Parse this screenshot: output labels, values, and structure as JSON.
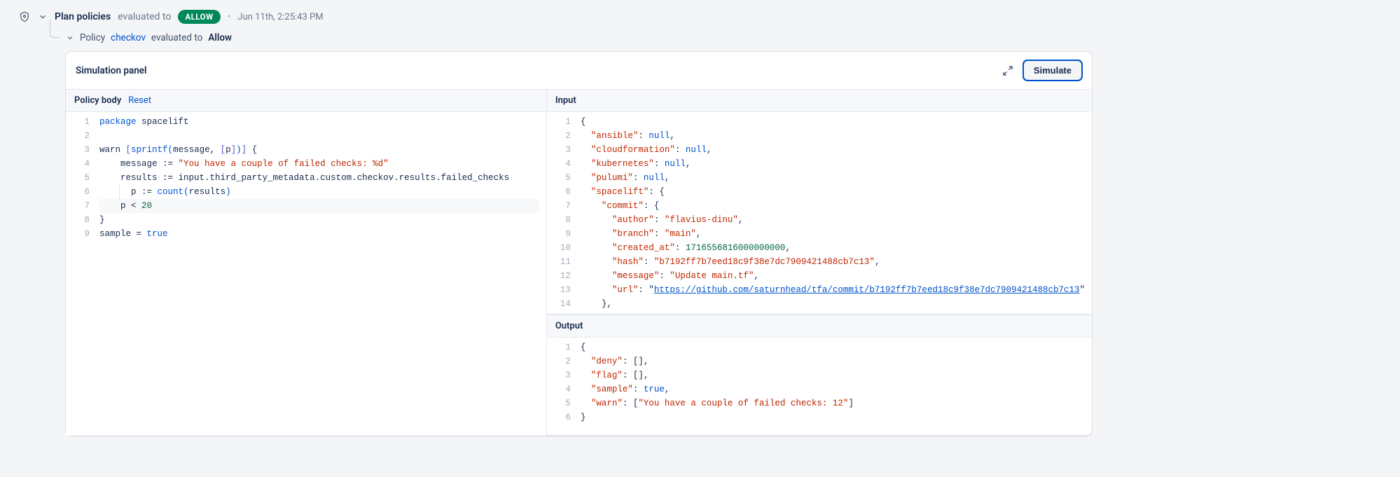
{
  "header": {
    "title": "Plan policies",
    "evaluated_to_text": "evaluated to",
    "badge": "ALLOW",
    "timestamp": "Jun 11th, 2:25:43 PM"
  },
  "sub_header": {
    "policy_label": "Policy",
    "policy_name": "checkov",
    "evaluated_to_text": "evaluated to",
    "result": "Allow"
  },
  "panel": {
    "title": "Simulation panel",
    "simulate_label": "Simulate"
  },
  "policy_body": {
    "title": "Policy body",
    "reset_label": "Reset",
    "lines": [
      [
        {
          "t": "package",
          "c": "tok-kw"
        },
        {
          "t": " spacelift",
          "c": "tok-id"
        }
      ],
      [],
      [
        {
          "t": "warn ",
          "c": "tok-id"
        },
        {
          "t": "[",
          "c": "tok-pn"
        },
        {
          "t": "sprintf",
          "c": "tok-fn"
        },
        {
          "t": "(",
          "c": "tok-pn2"
        },
        {
          "t": "message",
          "c": "tok-id"
        },
        {
          "t": ", ",
          "c": "tok-id"
        },
        {
          "t": "[",
          "c": "tok-pn"
        },
        {
          "t": "p",
          "c": "tok-id"
        },
        {
          "t": "]",
          "c": "tok-pn"
        },
        {
          "t": ")",
          "c": "tok-pn2"
        },
        {
          "t": "]",
          "c": "tok-pn"
        },
        {
          "t": " {",
          "c": ""
        }
      ],
      [
        {
          "t": "    message ",
          "c": "tok-id"
        },
        {
          "t": ":=",
          "c": "tok-op"
        },
        {
          "t": " ",
          "c": ""
        },
        {
          "t": "\"You have a couple of failed checks: %d\"",
          "c": "tok-str"
        }
      ],
      [
        {
          "t": "    results ",
          "c": "tok-id"
        },
        {
          "t": ":=",
          "c": "tok-op"
        },
        {
          "t": " input.third_party_metadata.custom.checkov.results.failed_checks",
          "c": "tok-id"
        }
      ],
      [
        {
          "t": "      p ",
          "c": "tok-id"
        },
        {
          "t": ":=",
          "c": "tok-op"
        },
        {
          "t": " ",
          "c": ""
        },
        {
          "t": "count",
          "c": "tok-fn"
        },
        {
          "t": "(",
          "c": "tok-pn2"
        },
        {
          "t": "results",
          "c": "tok-id"
        },
        {
          "t": ")",
          "c": "tok-pn2"
        }
      ],
      [
        {
          "t": "    p ",
          "c": "tok-id"
        },
        {
          "t": "<",
          "c": "tok-op"
        },
        {
          "t": " ",
          "c": ""
        },
        {
          "t": "20",
          "c": "tok-num"
        }
      ],
      [
        {
          "t": "}",
          "c": ""
        }
      ],
      [
        {
          "t": "sample ",
          "c": "tok-id"
        },
        {
          "t": "= ",
          "c": "tok-op"
        },
        {
          "t": "true",
          "c": "tok-bool"
        }
      ]
    ],
    "highlight_line_index": 6,
    "indent_bar_lines": [
      5
    ]
  },
  "input": {
    "title": "Input",
    "lines": [
      [
        {
          "t": "{",
          "c": ""
        }
      ],
      [
        {
          "t": "  ",
          "c": ""
        },
        {
          "t": "\"ansible\"",
          "c": "tok-key"
        },
        {
          "t": ": ",
          "c": ""
        },
        {
          "t": "null",
          "c": "tok-null"
        },
        {
          "t": ",",
          "c": ""
        }
      ],
      [
        {
          "t": "  ",
          "c": ""
        },
        {
          "t": "\"cloudformation\"",
          "c": "tok-key"
        },
        {
          "t": ": ",
          "c": ""
        },
        {
          "t": "null",
          "c": "tok-null"
        },
        {
          "t": ",",
          "c": ""
        }
      ],
      [
        {
          "t": "  ",
          "c": ""
        },
        {
          "t": "\"kubernetes\"",
          "c": "tok-key"
        },
        {
          "t": ": ",
          "c": ""
        },
        {
          "t": "null",
          "c": "tok-null"
        },
        {
          "t": ",",
          "c": ""
        }
      ],
      [
        {
          "t": "  ",
          "c": ""
        },
        {
          "t": "\"pulumi\"",
          "c": "tok-key"
        },
        {
          "t": ": ",
          "c": ""
        },
        {
          "t": "null",
          "c": "tok-null"
        },
        {
          "t": ",",
          "c": ""
        }
      ],
      [
        {
          "t": "  ",
          "c": ""
        },
        {
          "t": "\"spacelift\"",
          "c": "tok-key"
        },
        {
          "t": ": {",
          "c": ""
        }
      ],
      [
        {
          "t": "    ",
          "c": ""
        },
        {
          "t": "\"commit\"",
          "c": "tok-key"
        },
        {
          "t": ": {",
          "c": ""
        }
      ],
      [
        {
          "t": "      ",
          "c": ""
        },
        {
          "t": "\"author\"",
          "c": "tok-key"
        },
        {
          "t": ": ",
          "c": ""
        },
        {
          "t": "\"flavius-dinu\"",
          "c": "tok-str"
        },
        {
          "t": ",",
          "c": ""
        }
      ],
      [
        {
          "t": "      ",
          "c": ""
        },
        {
          "t": "\"branch\"",
          "c": "tok-key"
        },
        {
          "t": ": ",
          "c": ""
        },
        {
          "t": "\"main\"",
          "c": "tok-str"
        },
        {
          "t": ",",
          "c": ""
        }
      ],
      [
        {
          "t": "      ",
          "c": ""
        },
        {
          "t": "\"created_at\"",
          "c": "tok-key"
        },
        {
          "t": ": ",
          "c": ""
        },
        {
          "t": "1716556816000000000",
          "c": "tok-num"
        },
        {
          "t": ",",
          "c": ""
        }
      ],
      [
        {
          "t": "      ",
          "c": ""
        },
        {
          "t": "\"hash\"",
          "c": "tok-key"
        },
        {
          "t": ": ",
          "c": ""
        },
        {
          "t": "\"b7192ff7b7eed18c9f38e7dc7909421488cb7c13\"",
          "c": "tok-str"
        },
        {
          "t": ",",
          "c": ""
        }
      ],
      [
        {
          "t": "      ",
          "c": ""
        },
        {
          "t": "\"message\"",
          "c": "tok-key"
        },
        {
          "t": ": ",
          "c": ""
        },
        {
          "t": "\"Update main.tf\"",
          "c": "tok-str"
        },
        {
          "t": ",",
          "c": ""
        }
      ],
      [
        {
          "t": "      ",
          "c": ""
        },
        {
          "t": "\"url\"",
          "c": "tok-key"
        },
        {
          "t": ": \"",
          "c": ""
        },
        {
          "t": "https://github.com/saturnhead/tfa/commit/b7192ff7b7eed18c9f38e7dc7909421488cb7c13",
          "c": "tok-url"
        },
        {
          "t": "\"",
          "c": ""
        }
      ],
      [
        {
          "t": "    },",
          "c": ""
        }
      ]
    ]
  },
  "output": {
    "title": "Output",
    "lines": [
      [
        {
          "t": "{",
          "c": ""
        }
      ],
      [
        {
          "t": "  ",
          "c": ""
        },
        {
          "t": "\"deny\"",
          "c": "tok-key"
        },
        {
          "t": ": [],",
          "c": ""
        }
      ],
      [
        {
          "t": "  ",
          "c": ""
        },
        {
          "t": "\"flag\"",
          "c": "tok-key"
        },
        {
          "t": ": [],",
          "c": ""
        }
      ],
      [
        {
          "t": "  ",
          "c": ""
        },
        {
          "t": "\"sample\"",
          "c": "tok-key"
        },
        {
          "t": ": ",
          "c": ""
        },
        {
          "t": "true",
          "c": "tok-bool"
        },
        {
          "t": ",",
          "c": ""
        }
      ],
      [
        {
          "t": "  ",
          "c": ""
        },
        {
          "t": "\"warn\"",
          "c": "tok-key"
        },
        {
          "t": ": [",
          "c": ""
        },
        {
          "t": "\"You have a couple of failed checks: 12\"",
          "c": "tok-str"
        },
        {
          "t": "]",
          "c": ""
        }
      ],
      [
        {
          "t": "}",
          "c": ""
        }
      ]
    ]
  }
}
